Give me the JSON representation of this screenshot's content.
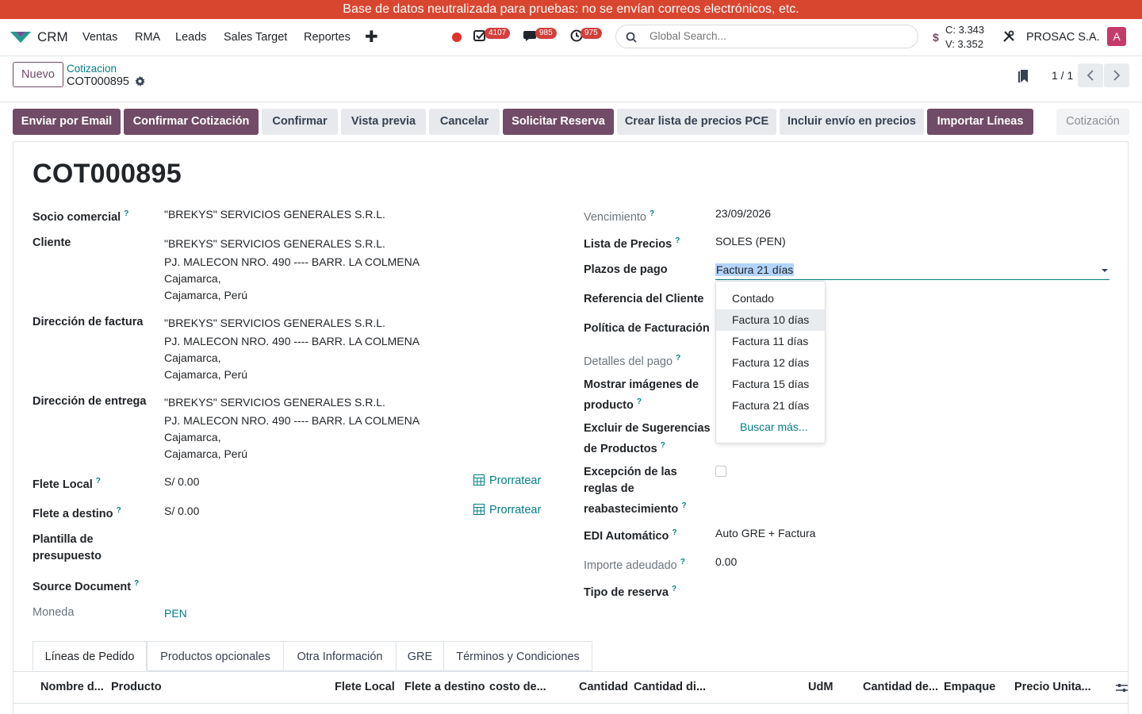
{
  "banner": "Base de datos neutralizada para pruebas: no se envían correos electrónicos, etc.",
  "nav": {
    "app": "CRM",
    "menus": [
      "Ventas",
      "RMA",
      "Leads",
      "Sales Target",
      "Reportes"
    ],
    "badges": {
      "activities": "4107",
      "messages": "985",
      "clock": "975"
    },
    "search_placeholder": "Global Search...",
    "rate_c": "C: 3.343",
    "rate_v": "V: 3.352",
    "currency_symbol": "$",
    "company": "PROSAC S.A.",
    "avatar": "A"
  },
  "control": {
    "new_label": "Nuevo",
    "breadcrumb_parent": "Cotizacion",
    "breadcrumb_current": "COT000895",
    "pager": "1 / 1"
  },
  "actions": [
    "Enviar por Email",
    "Confirmar Cotización",
    "Confirmar",
    "Vista previa",
    "Cancelar",
    "Solicitar Reserva",
    "Crear lista de precios PCE",
    "Incluir envío en precios",
    "Importar Líneas"
  ],
  "status": "Cotización",
  "form": {
    "title": "COT000895",
    "left": {
      "socio_label": "Socio comercial",
      "socio_value": "\"BREKYS\" SERVICIOS GENERALES S.R.L.",
      "cliente_label": "Cliente",
      "cliente_lines": [
        "\"BREKYS\" SERVICIOS GENERALES S.R.L.",
        "PJ. MALECON NRO. 490 ---- BARR. LA COLMENA",
        "Cajamarca,",
        "Cajamarca, Perú"
      ],
      "factura_label": "Dirección de factura",
      "factura_lines": [
        "\"BREKYS\" SERVICIOS GENERALES S.R.L.",
        "PJ. MALECON NRO. 490 ---- BARR. LA COLMENA",
        "Cajamarca,",
        "Cajamarca, Perú"
      ],
      "entrega_label": "Dirección de entrega",
      "entrega_lines": [
        "\"BREKYS\" SERVICIOS GENERALES S.R.L.",
        "PJ. MALECON NRO. 490 ---- BARR. LA COLMENA",
        "Cajamarca,",
        "Cajamarca, Perú"
      ],
      "flete_local_label": "Flete Local",
      "flete_local_value": "S/ 0.00",
      "flete_destino_label": "Flete a destino",
      "flete_destino_value": "S/ 0.00",
      "prorratear": "Prorratear",
      "plantilla_label_1": "Plantilla de",
      "plantilla_label_2": "presupuesto",
      "source_label": "Source Document",
      "moneda_label": "Moneda",
      "moneda_value": "PEN"
    },
    "right": {
      "vencimiento_label": "Vencimiento",
      "vencimiento_value": "23/09/2026",
      "lista_label": "Lista de Precios",
      "lista_value": "SOLES (PEN)",
      "plazos_label": "Plazos de pago",
      "plazos_value": "Factura 21 días",
      "referencia_label": "Referencia del Cliente",
      "politica_label": "Política de Facturación",
      "detalles_label": "Detalles del pago",
      "mostrar_label_1": "Mostrar imágenes de",
      "mostrar_label_2": "producto",
      "excluir_label_1": "Excluir de Sugerencias",
      "excluir_label_2": "de Productos",
      "excepcion_label_1": "Excepción de las",
      "excepcion_label_2": "reglas de",
      "excepcion_label_3": "reabastecimiento",
      "edi_label": "EDI Automático",
      "edi_value": "Auto GRE + Factura",
      "importe_label": "Importe adeudado",
      "importe_value": "0.00",
      "reserva_label": "Tipo de reserva"
    },
    "help_mark": "?"
  },
  "dropdown": {
    "options": [
      "Contado",
      "Factura 10 días",
      "Factura 11 días",
      "Factura 12 días",
      "Factura 15 días",
      "Factura 21 días"
    ],
    "more": "Buscar más..."
  },
  "tabs": [
    "Líneas de Pedido",
    "Productos opcionales",
    "Otra Información",
    "GRE",
    "Términos y Condiciones"
  ],
  "columns": [
    "Nombre d...",
    "Producto",
    "Flete Local",
    "Flete a destino",
    "costo de...",
    "Cantidad",
    "Cantidad di...",
    "UdM",
    "Cantidad de...",
    "Empaque",
    "Precio Unita..."
  ]
}
